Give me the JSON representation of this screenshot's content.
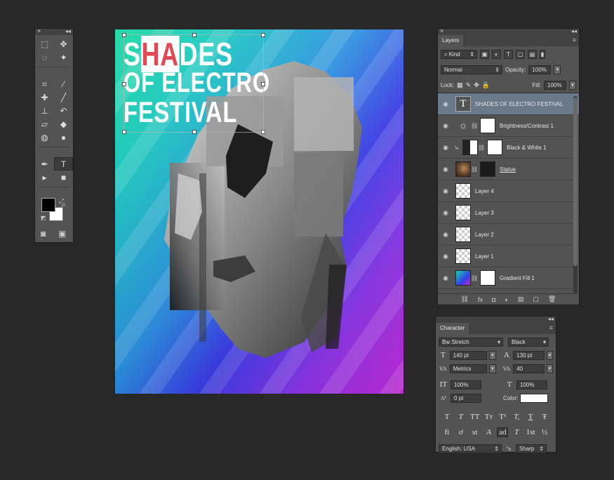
{
  "colors": {
    "workspace_bg": "#282828",
    "panel_bg": "#535353",
    "selected_layer": "#6a7a8c",
    "poster_highlight_text": "#e04a57"
  },
  "tools_panel": {
    "close_glyph": "×",
    "collapse_glyph": "◂◂",
    "tools": [
      {
        "name": "rect-marquee-icon",
        "glyph": "⬚"
      },
      {
        "name": "move-icon",
        "glyph": "✥"
      },
      {
        "name": "lasso-icon",
        "glyph": "◌"
      },
      {
        "name": "magic-wand-icon",
        "glyph": "✦"
      },
      {
        "name": "crop-icon",
        "glyph": "⌗"
      },
      {
        "name": "eyedropper-icon",
        "glyph": "⁄"
      },
      {
        "name": "healing-brush-icon",
        "glyph": "✚"
      },
      {
        "name": "brush-icon",
        "glyph": "╱"
      },
      {
        "name": "clone-stamp-icon",
        "glyph": "⊥"
      },
      {
        "name": "history-brush-icon",
        "glyph": "↶"
      },
      {
        "name": "eraser-icon",
        "glyph": "▱"
      },
      {
        "name": "paint-bucket-icon",
        "glyph": "◆"
      },
      {
        "name": "blur-icon",
        "glyph": "◍"
      },
      {
        "name": "dodge-icon",
        "glyph": "●"
      },
      {
        "name": "pen-icon",
        "glyph": "✒"
      },
      {
        "name": "type-icon",
        "glyph": "T"
      },
      {
        "name": "path-select-icon",
        "glyph": "▸"
      },
      {
        "name": "rectangle-shape-icon",
        "glyph": "■"
      },
      {
        "name": "hand-icon",
        "glyph": "✋"
      },
      {
        "name": "zoom-icon",
        "glyph": "⌕"
      }
    ],
    "selected_tool": "type-icon",
    "foreground_color": "#000000",
    "background_color": "#ffffff",
    "swap_glyph": "⤢",
    "default_glyph": "◩",
    "quick_mask_glyph": "◙",
    "screen_mode_glyph": "▣"
  },
  "poster": {
    "line1_pre": "S",
    "line1_highlight": "HA",
    "line1_post": "DES",
    "line2": "OF ELECTRO",
    "line3": "FESTIVAL"
  },
  "layers_panel": {
    "tab_label": "Layers",
    "menu_glyph": "≡",
    "filter_kind": "Kind",
    "blend_mode": "Normal",
    "opacity_label": "Opacity:",
    "opacity_value": "100%",
    "lock_label": "Lock:",
    "fill_label": "Fill:",
    "fill_value": "100%",
    "layers": [
      {
        "name": "SHADES  OF ELECTRO FESTIVAL",
        "kind": "text",
        "selected": true
      },
      {
        "name": "Brightness/Contrast 1",
        "kind": "adjust-bc",
        "selected": false
      },
      {
        "name": "Black & White 1",
        "kind": "adjust-bw",
        "selected": false
      },
      {
        "name": "Statue",
        "kind": "smart",
        "selected": false
      },
      {
        "name": "Layer 4",
        "kind": "pixel",
        "selected": false
      },
      {
        "name": "Layer 3",
        "kind": "pixel",
        "selected": false
      },
      {
        "name": "Layer 2",
        "kind": "pixel",
        "selected": false
      },
      {
        "name": "Layer 1",
        "kind": "pixel",
        "selected": false
      },
      {
        "name": "Gradient Fill 1",
        "kind": "gradient",
        "selected": false
      }
    ],
    "footer_icons": [
      "⛓",
      "fx",
      "◘",
      "◐",
      "▤",
      "▢",
      "🗑"
    ]
  },
  "character_panel": {
    "tab_label": "Character",
    "font_family": "Bw Stretch",
    "font_style": "Black",
    "font_size": "140 pt",
    "leading": "130 pt",
    "kerning": "Metrics",
    "tracking": "40",
    "vertical_scale": "100%",
    "horizontal_scale": "100%",
    "baseline_shift": "0 pt",
    "color_label": "Color:",
    "color_value": "#ffffff",
    "language": "English: USA",
    "aa_icon": "ªa",
    "anti_alias": "Sharp",
    "style_glyphs": [
      "T",
      "T",
      "TT",
      "Tт",
      "T¹",
      "T,",
      "T",
      "Ŧ"
    ],
    "opentype_glyphs": [
      "fi",
      "ơ",
      "st",
      "A",
      "ad",
      "T",
      "1st",
      "½"
    ]
  }
}
